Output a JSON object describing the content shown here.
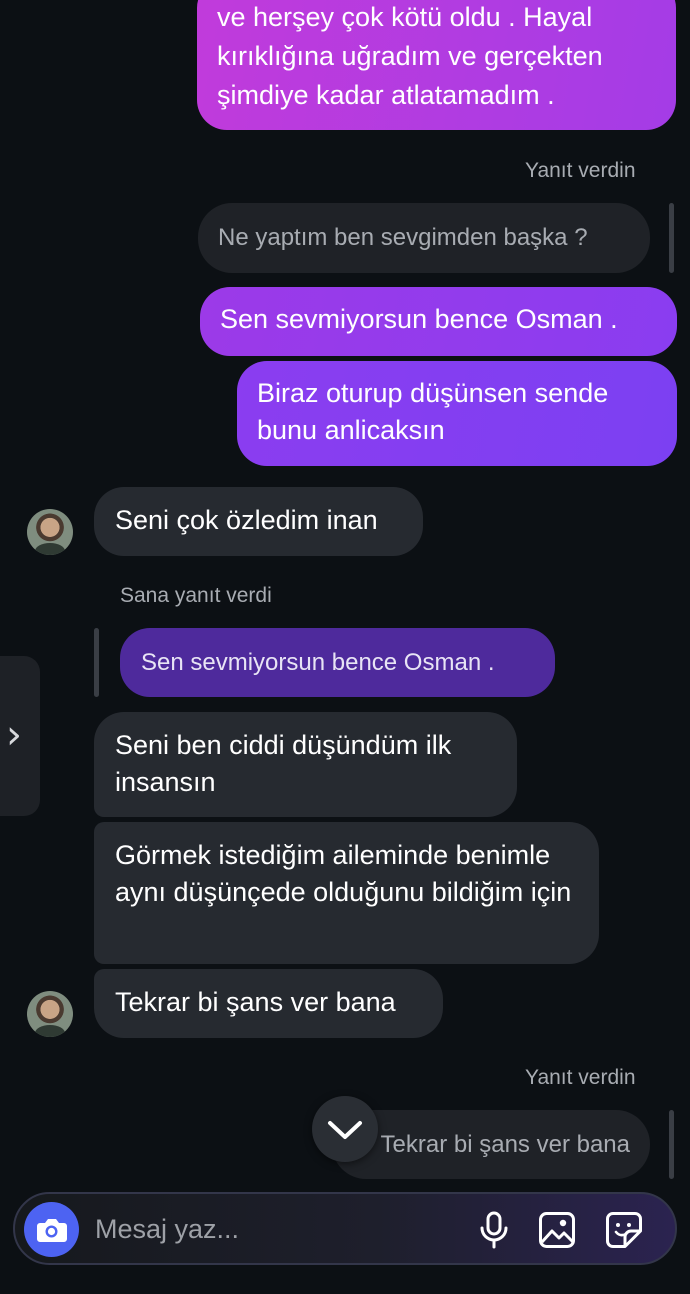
{
  "messages": {
    "top_partial": "ve herşey çok kötü oldu . Hayal kırıklığına uğradım  ve gerçekten şimdiye kadar atlatamadım .",
    "you_replied_1": "Yanıt verdin",
    "quoted_1": "Ne yaptım ben sevgimden başka ?",
    "out_1": "Sen sevmiyorsun bence Osman .",
    "out_2": "Biraz oturup düşünsen sende bunu anlicaksın",
    "in_1": "Seni çok özledim inan",
    "replied_to_you": "Sana yanıt verdi",
    "quoted_2": "Sen sevmiyorsun bence Osman .",
    "in_2": "Seni ben ciddi düşündüm ilk insansın",
    "in_3": "Görmek istediğim aileminde benimle aynı düşünçede olduğunu bildiğim için",
    "in_4": "Tekrar bi şans ver bana",
    "you_replied_2": "Yanıt verdin",
    "quoted_3": "Tekrar bi şans ver bana"
  },
  "composer": {
    "placeholder": "Mesaj yaz..."
  },
  "icons": {
    "camera": "camera-icon",
    "mic": "microphone-icon",
    "gallery": "image-icon",
    "sticker": "sticker-icon",
    "scroll_down": "chevron-down-icon",
    "side_tab": "chevron-right-icon"
  },
  "colors": {
    "background": "#0c1014",
    "outgoing_start": "#a838e0",
    "outgoing_end": "#7b3ff0",
    "incoming": "#262a30",
    "camera_button": "#4d63f2"
  }
}
